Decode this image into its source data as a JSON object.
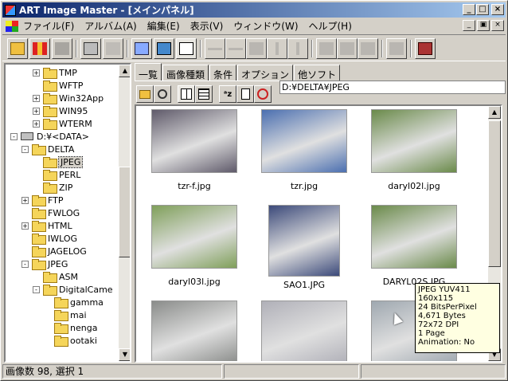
{
  "title": "ART Image Master - [メインパネル]",
  "menu": [
    "ファイル(F)",
    "アルバム(A)",
    "編集(E)",
    "表示(V)",
    "ウィンドウ(W)",
    "ヘルプ(H)"
  ],
  "window_buttons": {
    "minimize": "_",
    "maximize": "□",
    "close": "×"
  },
  "mdi_buttons": {
    "minimize": "_",
    "restore": "▣",
    "close": "×"
  },
  "tree": {
    "items": [
      {
        "label": "TMP",
        "level": 2,
        "exp": "+"
      },
      {
        "label": "WFTP",
        "level": 2,
        "exp": ""
      },
      {
        "label": "Win32App",
        "level": 2,
        "exp": "+"
      },
      {
        "label": "WIN95",
        "level": 2,
        "exp": "+"
      },
      {
        "label": "WTERM",
        "level": 2,
        "exp": "+"
      },
      {
        "label": "D:¥<DATA>",
        "level": 0,
        "exp": "-",
        "drive": true
      },
      {
        "label": "DELTA",
        "level": 1,
        "exp": "-"
      },
      {
        "label": "JPEG",
        "level": 2,
        "exp": "",
        "selected": true
      },
      {
        "label": "PERL",
        "level": 2,
        "exp": ""
      },
      {
        "label": "ZIP",
        "level": 2,
        "exp": ""
      },
      {
        "label": "FTP",
        "level": 1,
        "exp": "+"
      },
      {
        "label": "FWLOG",
        "level": 1,
        "exp": ""
      },
      {
        "label": "HTML",
        "level": 1,
        "exp": "+"
      },
      {
        "label": "IWLOG",
        "level": 1,
        "exp": ""
      },
      {
        "label": "JAGELOG",
        "level": 1,
        "exp": ""
      },
      {
        "label": "JPEG",
        "level": 1,
        "exp": "-"
      },
      {
        "label": "ASM",
        "level": 2,
        "exp": ""
      },
      {
        "label": "DigitalCame",
        "level": 2,
        "exp": "-"
      },
      {
        "label": "gamma",
        "level": 3,
        "exp": ""
      },
      {
        "label": "mai",
        "level": 3,
        "exp": ""
      },
      {
        "label": "nenga",
        "level": 3,
        "exp": ""
      },
      {
        "label": "ootaki",
        "level": 3,
        "exp": ""
      }
    ]
  },
  "tabs": [
    "一覧",
    "画像種類",
    "条件",
    "オプション",
    "他ソフト"
  ],
  "path": "D:¥DELTA¥JPEG",
  "thumbnails": [
    {
      "name": "tzr-f.jpg",
      "color": "#5f5a6a"
    },
    {
      "name": "tzr.jpg",
      "color": "#4b6fb0"
    },
    {
      "name": "daryl02l.jpg",
      "color": "#6a8a4a"
    },
    {
      "name": "daryl03l.jpg",
      "color": "#7f9f5a"
    },
    {
      "name": "SAO1.JPG",
      "color": "#3c4a7a"
    },
    {
      "name": "DARYL02S.JPG",
      "color": "#6a8a4a"
    },
    {
      "name": "",
      "color": "#8a8c8a"
    },
    {
      "name": "",
      "color": "#b0b0b8"
    },
    {
      "name": "",
      "color": "#9fa8b0"
    }
  ],
  "tooltip": [
    "JPEG YUV411",
    "160x115",
    "24 BitsPerPixel",
    "4,671 Bytes",
    "72x72 DPI",
    "1 Page",
    "Animation: No"
  ],
  "status": {
    "left": "画像数 98, 選択 1",
    "middle": "",
    "right": ""
  },
  "colors": {
    "title_start": "#0a246a",
    "title_end": "#a6caf0",
    "face": "#d4d0c8",
    "tooltip_bg": "#ffffe1"
  }
}
